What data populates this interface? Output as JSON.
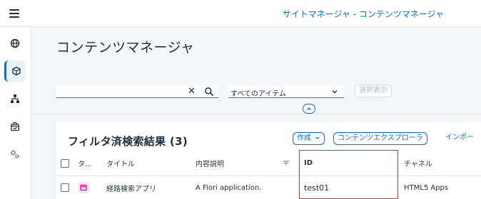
{
  "shell": {
    "menu_icon": "hamburger-menu-icon",
    "title": "サイトマネージャ - コンテンツマネージャ"
  },
  "sidenav": {
    "items": [
      {
        "icon": "globe-icon",
        "label": "Sites"
      },
      {
        "icon": "cube-icon",
        "label": "Content Manager",
        "active": true
      },
      {
        "icon": "hierarchy-icon",
        "label": "Channels"
      },
      {
        "icon": "package-icon",
        "label": "Packages"
      },
      {
        "icon": "settings-icon",
        "label": "Settings"
      }
    ]
  },
  "page": {
    "title": "コンテンツマネージャ"
  },
  "filter_bar": {
    "search_value": "",
    "search_placeholder": "",
    "clear_glyph": "✕",
    "item_filter_value": "すべてのアイテム",
    "show_selected_label": "選択表示"
  },
  "table": {
    "title": "フィルタ済検索結果 (3)",
    "create_label": "作成",
    "explorer_label": "コンテンツエクスプローラ",
    "import_label": "インポー",
    "columns": {
      "type": "タ...",
      "title": "タイトル",
      "description": "内容説明",
      "id": "ID",
      "channel": "チャネル"
    },
    "rows": [
      {
        "title": "経路検索アプリ",
        "description": "A Fiori application.",
        "id": "test01",
        "channel": "HTML5 Apps"
      }
    ]
  },
  "colors": {
    "accent": "#0a6ed1",
    "highlight": "#e03131",
    "type_icon_bg": "#fbe3f4",
    "type_icon_fg": "#d000a8"
  }
}
